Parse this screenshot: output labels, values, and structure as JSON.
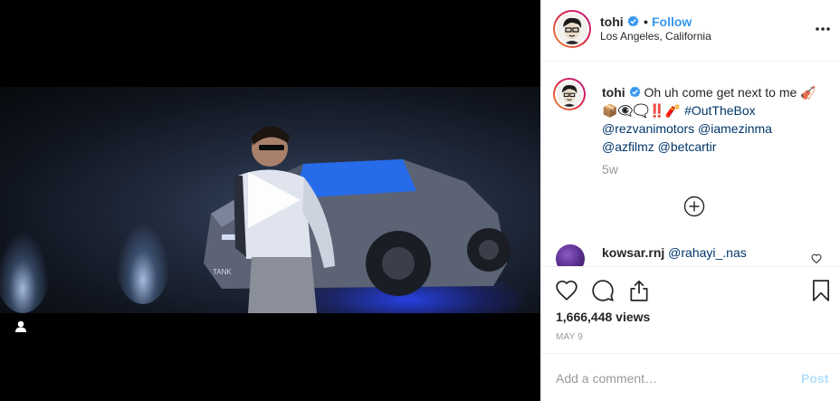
{
  "post": {
    "author": {
      "username": "tohi",
      "location": "Los Angeles, California",
      "verified": true,
      "follow_label": "Follow",
      "separator": "•"
    },
    "caption": {
      "username": "tohi",
      "text_start": "Oh uh come get next to me 🎻",
      "emoji_line": "📦👁️‍🗨️🗨️‼️🧨",
      "hashtag": "#OutTheBox",
      "mentions": [
        "@rezvanimotors",
        "@iamezinma",
        "@azfilmz",
        "@betcartir"
      ],
      "time": "5w"
    },
    "comment": {
      "username": "kowsar.rnj",
      "mention": "@rahayi_.nas"
    },
    "stats": {
      "views": "1,666,448 views",
      "date": "MAY 9"
    },
    "add_comment": {
      "placeholder": "Add a comment…",
      "post_label": "Post"
    }
  },
  "icons": {
    "video_play": "play-icon",
    "user_tag": "user-icon",
    "more": "more-options-icon",
    "load_more": "plus-circle-icon",
    "like": "heart-icon",
    "comment": "comment-bubble-icon",
    "share": "share-icon",
    "save": "bookmark-icon",
    "verified": "verified-badge-icon"
  },
  "colors": {
    "link_blue": "#3897f0",
    "mention_blue": "#003569",
    "muted_gray": "#999999",
    "post_disabled": "#b2dffc"
  }
}
